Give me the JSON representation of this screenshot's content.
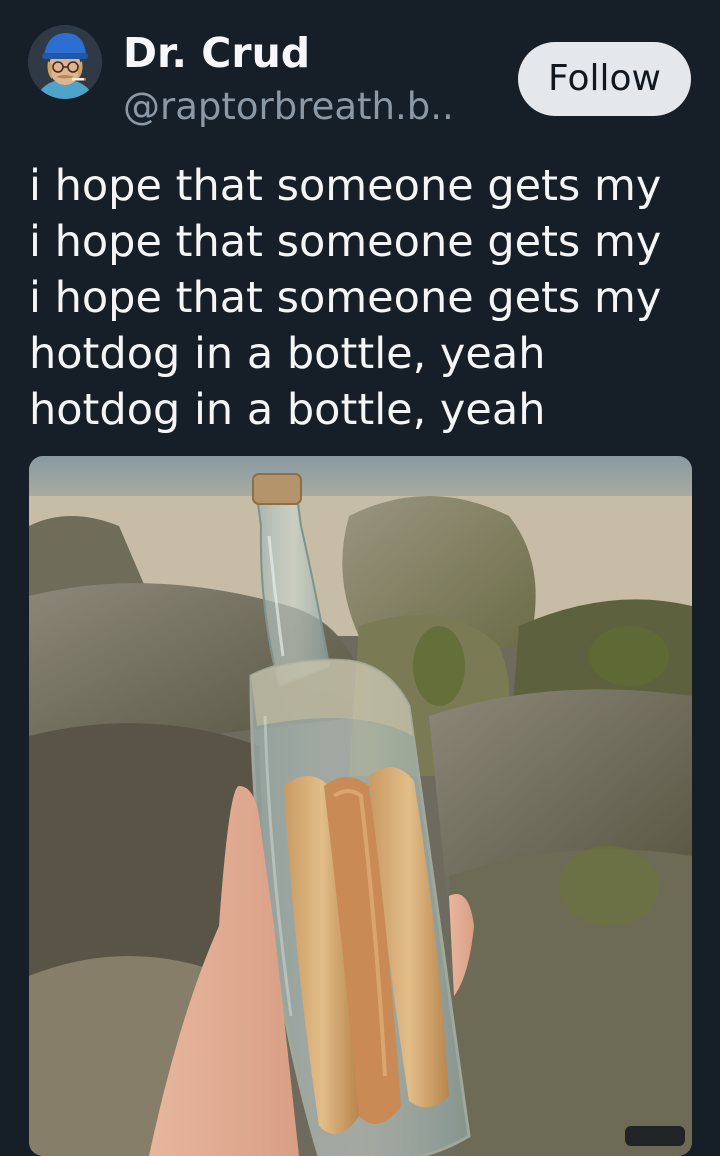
{
  "post": {
    "author": {
      "display_name": "Dr. Crud",
      "handle": "@raptorbreath.b..",
      "avatar_icon": "avatar-man-blue-cap"
    },
    "follow_label": "Follow",
    "text_lines": [
      "i hope that someone gets my",
      "i hope that someone gets my",
      "i hope that someone gets my",
      "hotdog in a bottle, yeah",
      "hotdog in a bottle, yeah"
    ],
    "image": {
      "icon": "photo-hotdog-in-bottle-on-beach-rocks"
    }
  },
  "colors": {
    "background": "#161e27",
    "text": "#f3f5f7",
    "handle": "#8b98a5",
    "follow_button_bg": "#e4e8ec",
    "follow_button_text": "#111820"
  }
}
